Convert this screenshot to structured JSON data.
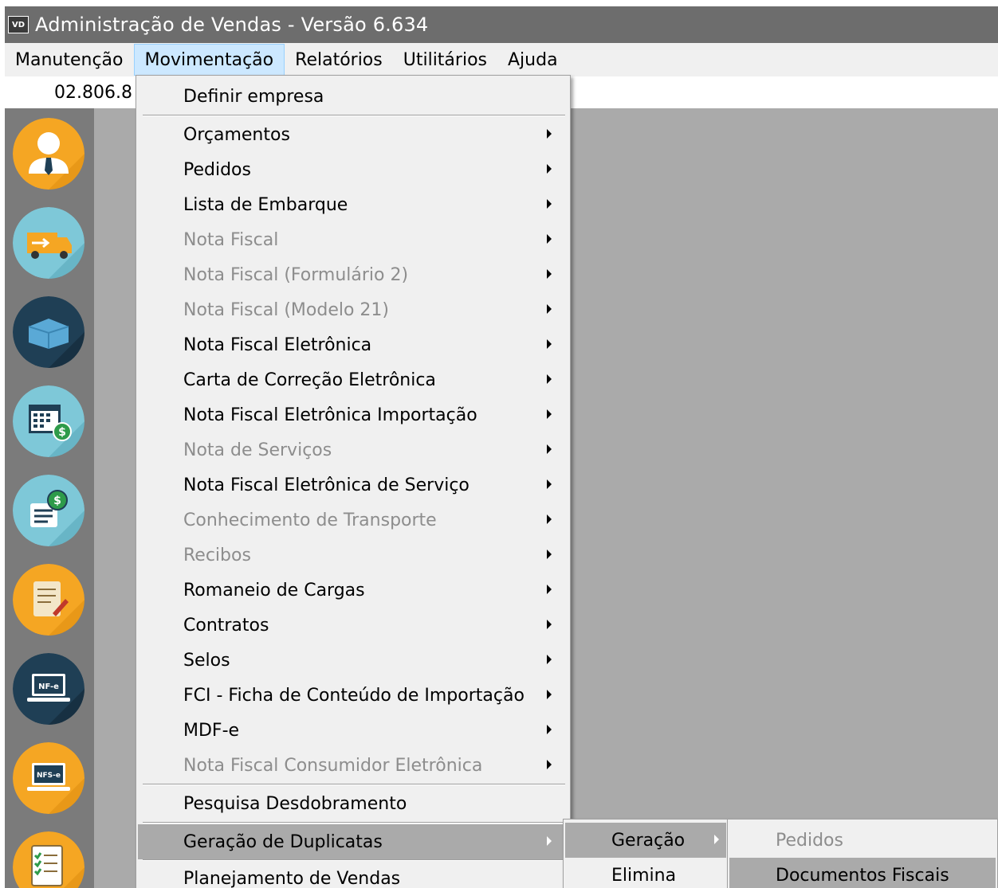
{
  "window": {
    "app_icon": "VD",
    "title": "Administração de Vendas - Versão 6.634"
  },
  "menubar": {
    "items": [
      {
        "label": "Manutenção"
      },
      {
        "label": "Movimentação"
      },
      {
        "label": "Relatórios"
      },
      {
        "label": "Utilitários"
      },
      {
        "label": "Ajuda"
      }
    ],
    "open_item": "Movimentação"
  },
  "company": {
    "code": "02.806.8"
  },
  "sidebar": {
    "buttons": [
      {
        "icon": "user-profile-icon",
        "color": "#f5a623"
      },
      {
        "icon": "delivery-truck-icon",
        "color": "#7ec8d8"
      },
      {
        "icon": "open-box-icon",
        "color": "#1f3f55"
      },
      {
        "icon": "calendar-money-icon",
        "color": "#7ec8d8"
      },
      {
        "icon": "invoice-money-icon",
        "color": "#7ec8d8"
      },
      {
        "icon": "document-sign-icon",
        "color": "#f5a623"
      },
      {
        "icon": "nfe-laptop-icon",
        "color": "#1f3f55"
      },
      {
        "icon": "nfse-laptop-icon",
        "color": "#f5a623"
      },
      {
        "icon": "checklist-icon",
        "color": "#f5a623"
      }
    ]
  },
  "movimentacao_menu": {
    "items": [
      {
        "label": "Definir empresa",
        "submenu": false,
        "enabled": true
      },
      {
        "label": "Orçamentos",
        "submenu": true,
        "enabled": true
      },
      {
        "label": "Pedidos",
        "submenu": true,
        "enabled": true
      },
      {
        "label": "Lista de Embarque",
        "submenu": true,
        "enabled": true
      },
      {
        "label": "Nota Fiscal",
        "submenu": true,
        "enabled": false
      },
      {
        "label": "Nota Fiscal (Formulário 2)",
        "submenu": true,
        "enabled": false
      },
      {
        "label": "Nota Fiscal (Modelo 21)",
        "submenu": true,
        "enabled": false
      },
      {
        "label": "Nota Fiscal Eletrônica",
        "submenu": true,
        "enabled": true
      },
      {
        "label": "Carta de Correção Eletrônica",
        "submenu": true,
        "enabled": true
      },
      {
        "label": "Nota Fiscal Eletrônica Importação",
        "submenu": true,
        "enabled": true
      },
      {
        "label": "Nota de Serviços",
        "submenu": true,
        "enabled": false
      },
      {
        "label": "Nota Fiscal Eletrônica de Serviço",
        "submenu": true,
        "enabled": true
      },
      {
        "label": "Conhecimento de Transporte",
        "submenu": true,
        "enabled": false
      },
      {
        "label": "Recibos",
        "submenu": true,
        "enabled": false
      },
      {
        "label": "Romaneio de Cargas",
        "submenu": true,
        "enabled": true
      },
      {
        "label": "Contratos",
        "submenu": true,
        "enabled": true
      },
      {
        "label": "Selos",
        "submenu": true,
        "enabled": true
      },
      {
        "label": "FCI - Ficha de Conteúdo de Importação",
        "submenu": true,
        "enabled": true
      },
      {
        "label": "MDF-e",
        "submenu": true,
        "enabled": true
      },
      {
        "label": "Nota Fiscal Consumidor Eletrônica",
        "submenu": true,
        "enabled": false
      },
      {
        "label": "Pesquisa Desdobramento",
        "submenu": false,
        "enabled": true
      },
      {
        "label": "Geração de Duplicatas",
        "submenu": true,
        "enabled": true,
        "highlighted": true
      },
      {
        "label": "Planejamento de Vendas",
        "submenu": false,
        "enabled": true
      }
    ]
  },
  "duplicatas_menu": {
    "items": [
      {
        "label": "Geração",
        "submenu": true,
        "highlighted": true
      },
      {
        "label": "Elimina",
        "submenu": false
      }
    ]
  },
  "geracao_menu": {
    "items": [
      {
        "label": "Pedidos",
        "enabled": false
      },
      {
        "label": "Documentos Fiscais",
        "enabled": true,
        "highlighted": true
      }
    ]
  }
}
